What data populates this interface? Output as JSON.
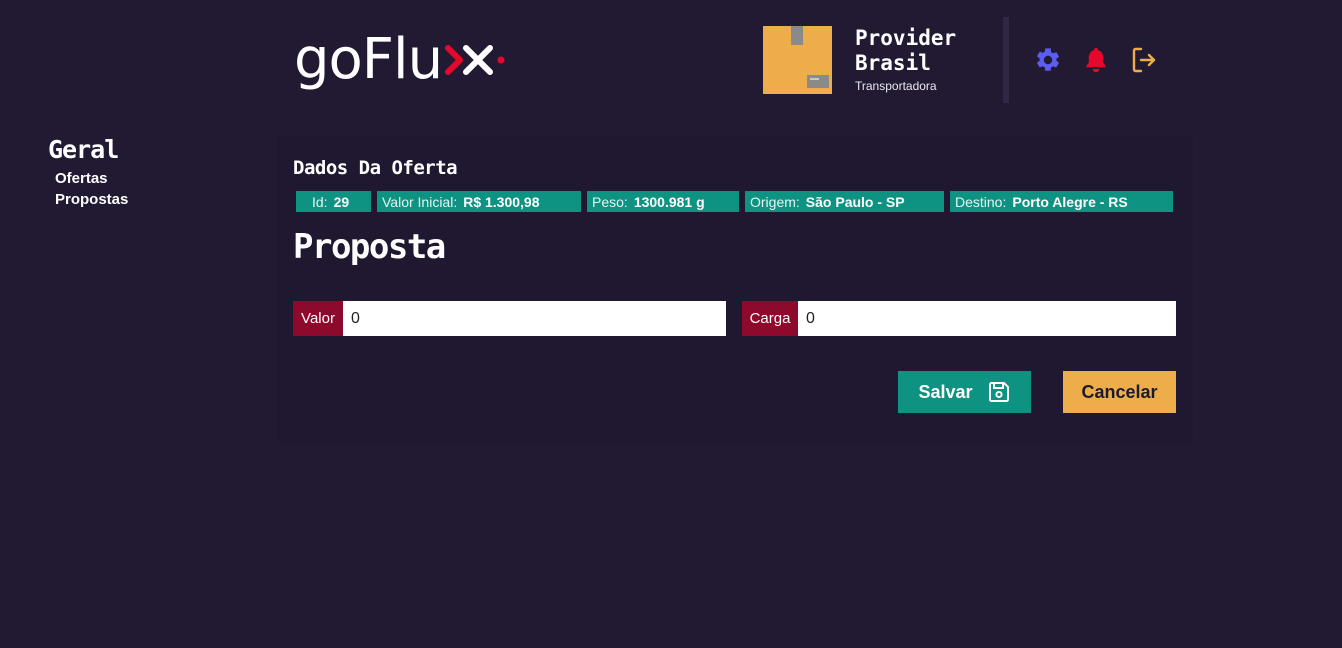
{
  "header": {
    "logo_text": "goFlu",
    "profile": {
      "name": "Provider Brasil",
      "role": "Transportadora"
    },
    "icons": {
      "settings": "gear-icon",
      "notifications": "bell-icon",
      "logout": "logout-icon"
    },
    "colors": {
      "settings": "#5b5cf0",
      "notifications": "#e5082b",
      "logout": "#ecad4a"
    }
  },
  "sidebar": {
    "title": "Geral",
    "items": [
      {
        "label": "Ofertas"
      },
      {
        "label": "Propostas"
      }
    ]
  },
  "main": {
    "offer_title": "Dados Da Oferta",
    "offer_tags": [
      {
        "key": "Id:",
        "value": "29"
      },
      {
        "key": "Valor Inicial:",
        "value": "R$ 1.300,98"
      },
      {
        "key": "Peso:",
        "value": "1300.981 g"
      },
      {
        "key": "Origem:",
        "value": "São Paulo - SP"
      },
      {
        "key": "Destino:",
        "value": "Porto Alegre - RS"
      }
    ],
    "proposal_title": "Proposta",
    "fields": {
      "valor": {
        "label": "Valor",
        "value": "0"
      },
      "carga": {
        "label": "Carga",
        "value": "0"
      }
    },
    "buttons": {
      "save": "Salvar",
      "cancel": "Cancelar"
    }
  },
  "theme": {
    "background": "#221a33",
    "accent_teal": "#0e9282",
    "accent_red": "#8e0a2c",
    "accent_yellow": "#ecad4a"
  }
}
